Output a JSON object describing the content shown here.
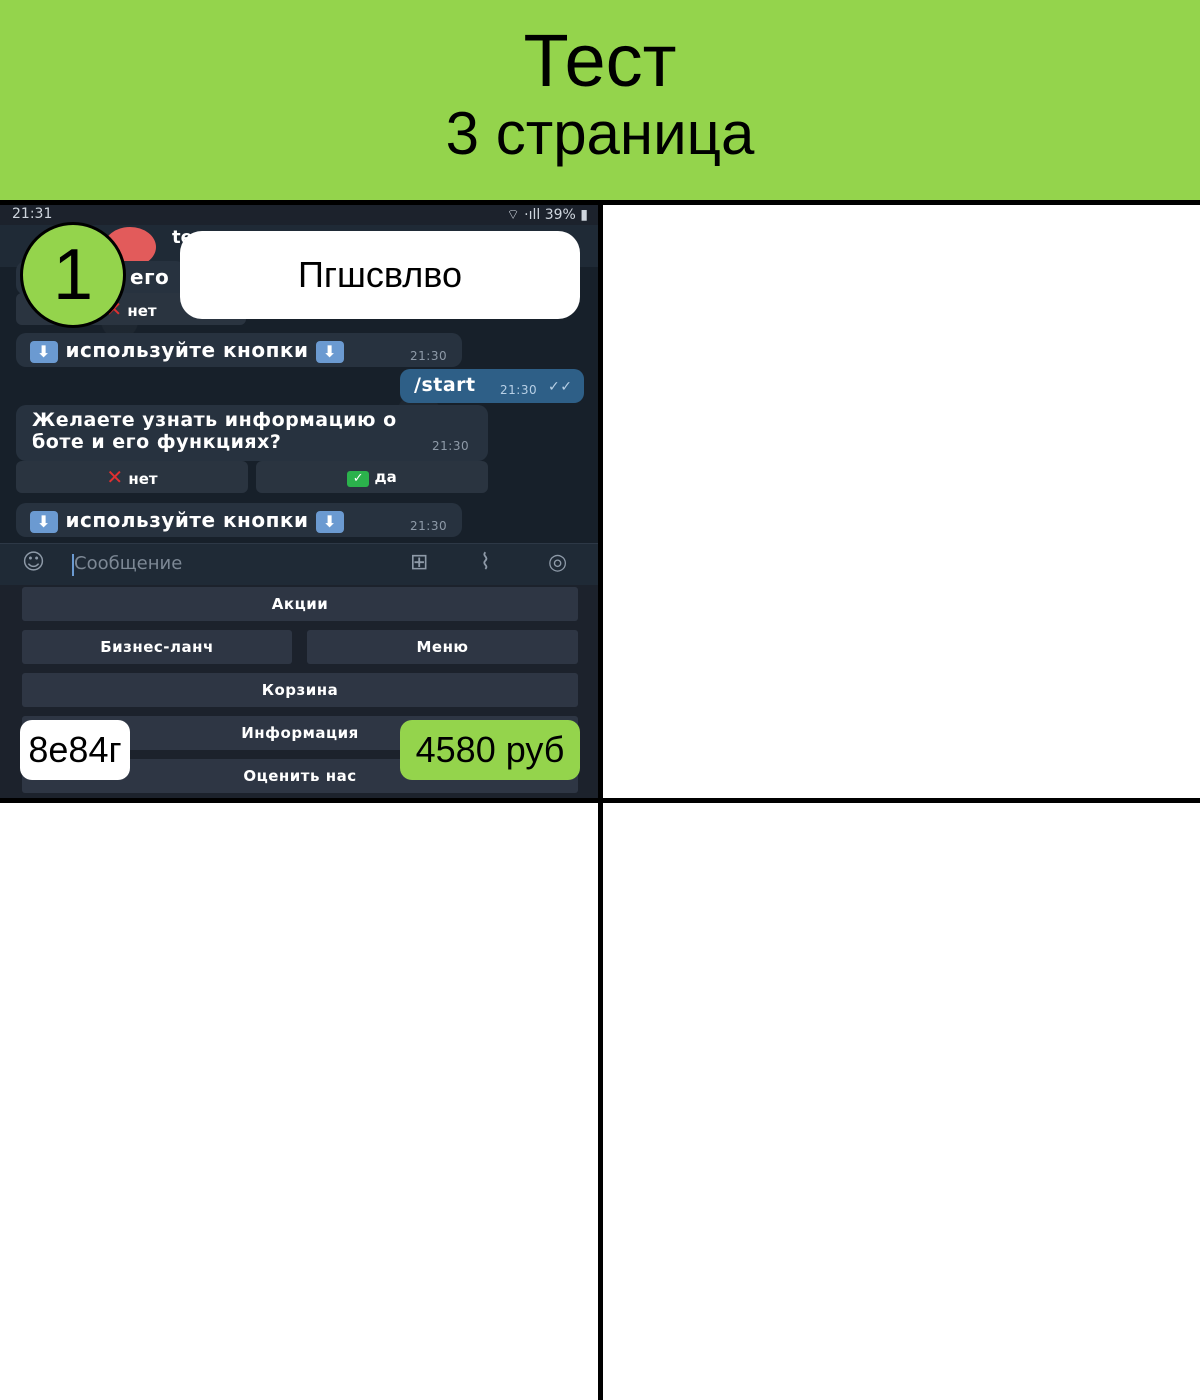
{
  "header": {
    "title": "Тест",
    "subtitle": "3 страница"
  },
  "phone": {
    "status": {
      "time": "21:31",
      "battery": "39%"
    },
    "bot_name": "te",
    "messages": [
      {
        "text": "его с",
        "partial": true
      },
      {
        "text": "используйте кнопки",
        "time": "21:30"
      },
      {
        "text": "/start",
        "time": "21:30",
        "outgoing": true
      },
      {
        "text_line1": "Желаете узнать информацию о",
        "text_line2": "боте и его функциях?",
        "time": "21:30"
      },
      {
        "text": "используйте кнопки",
        "time": "21:30"
      }
    ],
    "inline_buttons": {
      "no": "нет",
      "yes": "да"
    },
    "input_placeholder": "Сообщение",
    "keyboard": {
      "row1": "Акции",
      "row2_left": "Бизнес-ланч",
      "row2_right": "Меню",
      "row3": "Корзина",
      "row4": "Информация",
      "row5": "Оценить нас"
    }
  },
  "overlays": {
    "number": "1",
    "name": "Пгшсвлво",
    "code": "8е84г",
    "price": "4580 руб"
  },
  "colors": {
    "accent_green": "#94d44c",
    "chat_bg": "#17202a",
    "keyboard_button": "#2e3644",
    "outgoing_bubble": "#2e5f87"
  }
}
